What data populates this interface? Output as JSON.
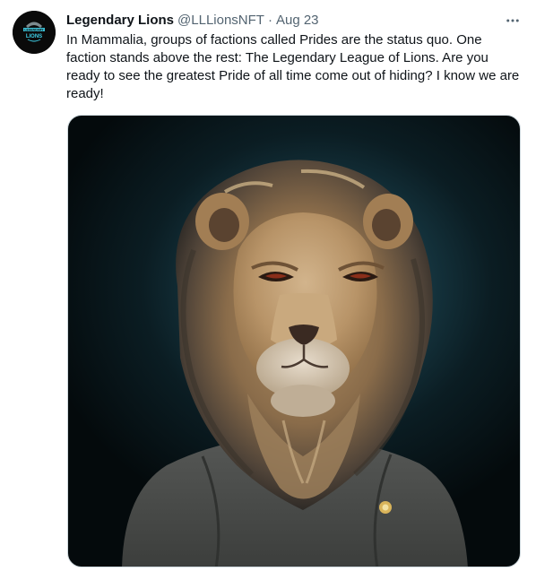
{
  "tweet": {
    "display_name": "Legendary Lions",
    "handle": "@LLLionsNFT",
    "separator": "·",
    "timestamp": "Aug 23",
    "text": "In Mammalia, groups of factions called Prides are the status quo. One faction stands above the rest: The Legendary League of Lions. Are you ready to see the greatest Pride of all time come out of hiding? I know we are ready!",
    "more_icon": "more-horizontal-icon",
    "avatar": {
      "logo_lines": [
        "LEGENDARY",
        "LIONS"
      ],
      "accent": "#3fd0e8"
    },
    "media": {
      "subject": "lion-in-grey-tshirt",
      "background": "#0b1d23",
      "shirt_color": "#4a4c4a"
    }
  }
}
